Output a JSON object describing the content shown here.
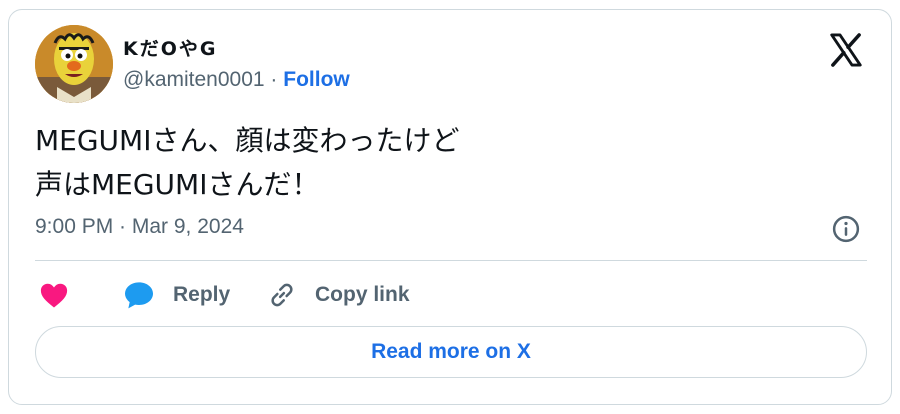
{
  "user": {
    "display_name": "KだOやG",
    "handle": "@kamiten0001",
    "separator": "·",
    "follow_label": "Follow"
  },
  "tweet": {
    "lines": [
      "MEGUMIさん、顔は変わったけど",
      "声はMEGUMIさんだ！"
    ],
    "timestamp": "9:00 PM · Mar 9, 2024"
  },
  "actions": {
    "like_label": "",
    "reply_label": "Reply",
    "copy_label": "Copy link"
  },
  "footer": {
    "read_more_label": "Read more on X"
  },
  "colors": {
    "link_blue": "#1d6fe5",
    "like_pink": "#f91880",
    "reply_blue": "#1d9bf0",
    "muted": "#536471",
    "border": "#cfd9de"
  },
  "icons": [
    "x-logo-icon",
    "info-icon",
    "heart-icon",
    "reply-bubble-icon",
    "link-icon"
  ]
}
